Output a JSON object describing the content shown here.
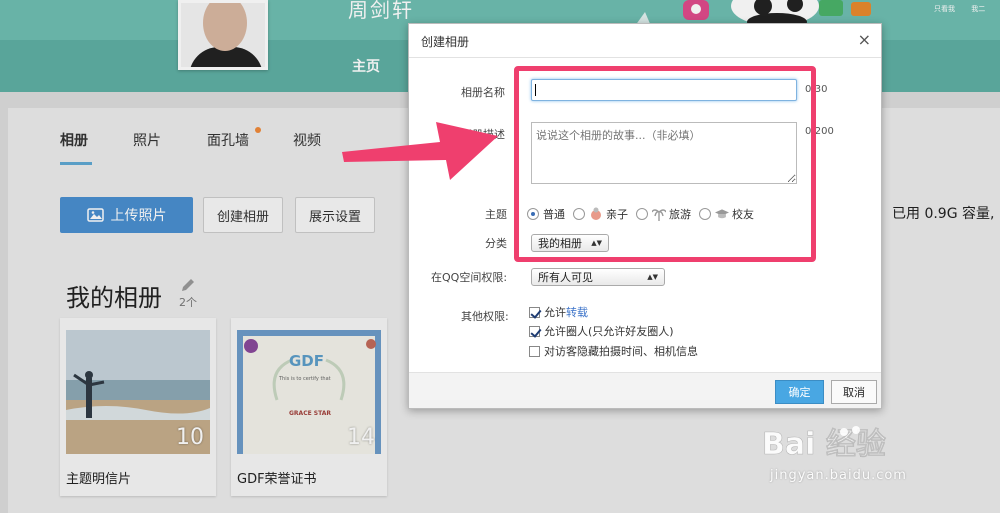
{
  "header": {
    "owner_name": "周剑轩",
    "nav_home": "主页"
  },
  "mini_menu": [
    "只看我",
    "我二"
  ],
  "tabs": [
    {
      "label": "相册",
      "active": true
    },
    {
      "label": "照片",
      "active": false
    },
    {
      "label": "面孔墙",
      "active": false,
      "badge": true
    },
    {
      "label": "视频",
      "active": false
    }
  ],
  "toolbar": {
    "upload_label": "上传照片",
    "create_label": "创建相册",
    "settings_label": "展示设置",
    "usage_text": "已用 0.9G 容量,"
  },
  "albums_section": {
    "heading": "我的相册",
    "count": "2个"
  },
  "albums": [
    {
      "title": "主题明信片",
      "count": "10"
    },
    {
      "title": "GDF荣誉证书",
      "count": "14"
    }
  ],
  "certificate": {
    "brand": "GDF",
    "line1": "This is to certify that",
    "holder": "GRACE STAR"
  },
  "dialog": {
    "title": "创建相册",
    "close": "×",
    "name_label": "相册名称",
    "name_value": "",
    "name_counter": "0/30",
    "desc_label": "相册描述",
    "desc_placeholder": "说说这个相册的故事...（非必填）",
    "desc_counter": "0/200",
    "theme_label": "主题",
    "theme_options": [
      {
        "label": "普通",
        "selected": true
      },
      {
        "label": "亲子",
        "selected": false,
        "icon": "baby-icon"
      },
      {
        "label": "旅游",
        "selected": false,
        "icon": "palm-tree-icon"
      },
      {
        "label": "校友",
        "selected": false,
        "icon": "graduation-cap-icon"
      }
    ],
    "category_label": "分类",
    "category_value": "我的相册",
    "permission_label": "在QQ空间权限:",
    "permission_value": "所有人可见",
    "other_label": "其他权限:",
    "checkboxes": [
      {
        "prefix": "允许",
        "link": "转载",
        "suffix": "",
        "checked": true
      },
      {
        "prefix": "允许圈人(只允许好友圈人)",
        "link": "",
        "suffix": "",
        "checked": true
      },
      {
        "prefix": "对访客隐藏拍摄时间、相机信息",
        "link": "",
        "suffix": "",
        "checked": false
      }
    ],
    "ok_label": "确定",
    "cancel_label": "取消"
  },
  "watermark": {
    "brand": "Bai 经验",
    "url": "jingyan.baidu.com"
  },
  "colors": {
    "accent_teal": "#5fb0a4",
    "upload_blue": "#4a8fd0",
    "highlight_red": "#ef3f6e",
    "ok_blue": "#49a7e3"
  }
}
